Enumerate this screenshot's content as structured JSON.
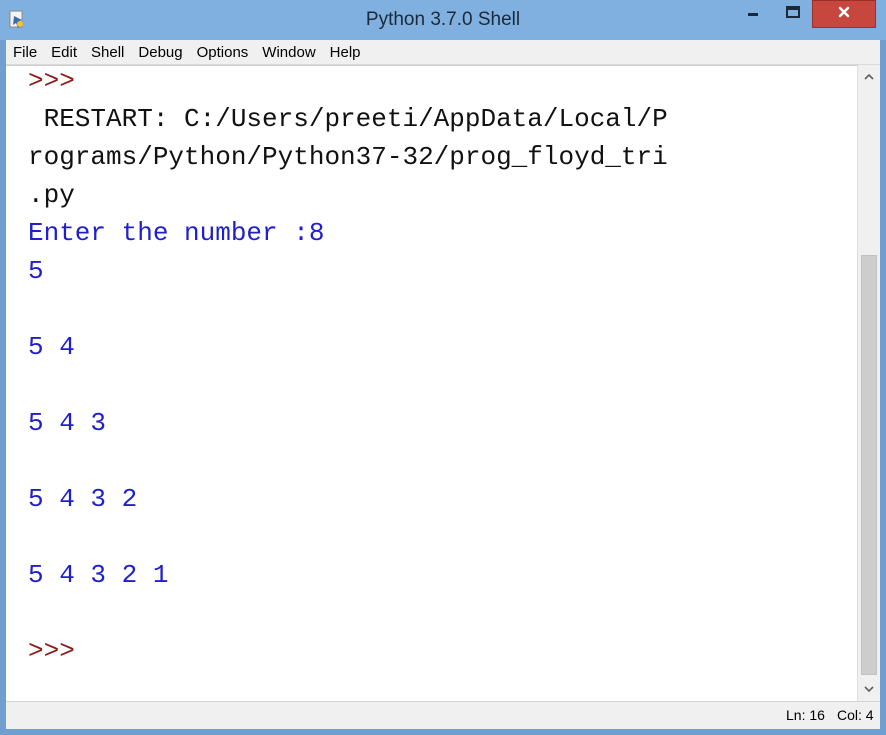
{
  "window": {
    "title": "Python 3.7.0 Shell"
  },
  "menu": [
    "File",
    "Edit",
    "Shell",
    "Debug",
    "Options",
    "Window",
    "Help"
  ],
  "shell": {
    "line_1": ">>>",
    "line_2": " RESTART: C:/Users/preeti/AppData/Local/P",
    "line_3": "rograms/Python/Python37-32/prog_floyd_tri",
    "line_4": ".py",
    "line_5_label": "Enter the number :",
    "line_5_value": "8",
    "line_6": "5",
    "line_7": "",
    "line_8": "5 4",
    "line_9": "",
    "line_10": "5 4 3",
    "line_11": "",
    "line_12": "5 4 3 2",
    "line_13": "",
    "line_14": "5 4 3 2 1",
    "line_15": "",
    "line_16": ">>>"
  },
  "status": {
    "ln": "Ln: 16",
    "col": "Col: 4"
  },
  "colors": {
    "prompt": "#8b1d16",
    "output": "#1f1fcc",
    "close_button": "#c7463d"
  },
  "icons": {
    "app": "python-idle-icon",
    "minimize": "minimize-icon",
    "maximize": "maximize-icon",
    "close": "close-icon",
    "scroll_up": "chevron-up-icon",
    "scroll_down": "chevron-down-icon"
  }
}
